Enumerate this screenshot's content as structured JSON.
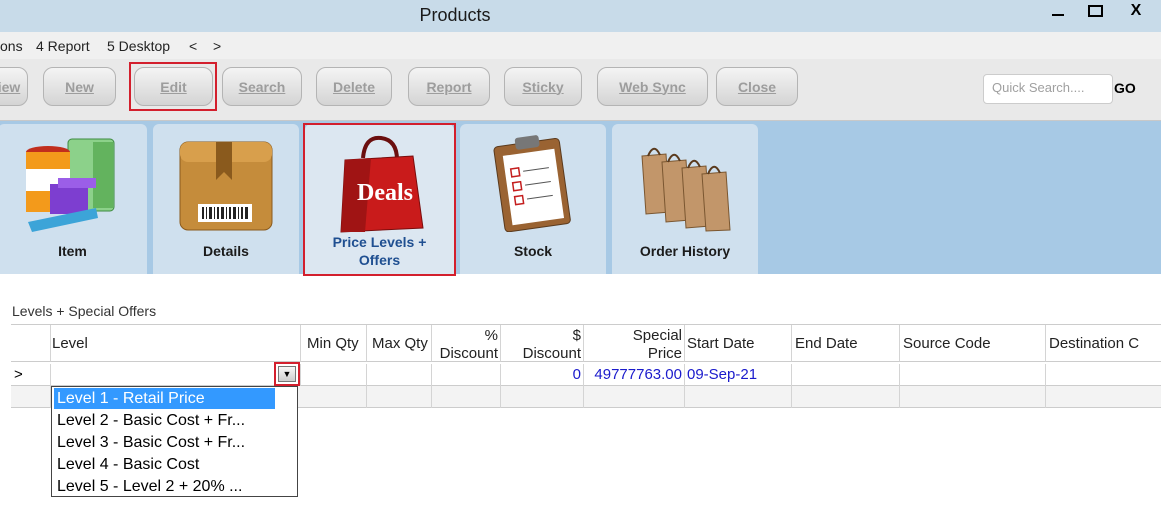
{
  "window": {
    "title": "Products",
    "min_icon": "minimize-icon",
    "max_icon": "maximize-icon",
    "close_icon": "close-icon",
    "close_glyph": "X"
  },
  "menu": {
    "items": [
      "ons",
      "4 Report",
      "5 Desktop",
      "<",
      ">"
    ]
  },
  "toolbar": {
    "buttons": [
      "iew",
      "New",
      "Edit",
      "Search",
      "Delete",
      "Report",
      "Sticky",
      "Web Sync",
      "Close"
    ],
    "search_placeholder": "Quick Search....",
    "go_label": "GO"
  },
  "tabs": [
    {
      "label": "Item",
      "icon": "products-icon"
    },
    {
      "label": "Details",
      "icon": "box-barcode-icon"
    },
    {
      "label_line1": "Price Levels +",
      "label_line2": "Offers",
      "icon": "deals-bag-icon",
      "badge": "Deals",
      "active": true
    },
    {
      "label": "Stock",
      "icon": "inventory-clipboard-icon"
    },
    {
      "label": "Order History",
      "icon": "shopping-bags-icon"
    }
  ],
  "section_title": "Levels + Special Offers",
  "grid": {
    "headers": {
      "level": "Level",
      "min_qty": "Min Qty",
      "max_qty": "Max Qty",
      "pct_discount_1": "%",
      "pct_discount_2": "Discount",
      "dollar_discount_1": "$",
      "dollar_discount_2": "Discount",
      "special_price_1": "Special",
      "special_price_2": "Price",
      "start_date": "Start Date",
      "end_date": "End Date",
      "source_code": "Source Code",
      "destination_code": "Destination C"
    },
    "row1": {
      "marker": ">",
      "pct_discount": "",
      "dollar_discount": "0",
      "special_price": "49777763.00",
      "start_date": "09-Sep-21"
    },
    "dropdown_button": "▼"
  },
  "dropdown": {
    "options": [
      "Level 1 - Retail Price",
      "Level 2 - Basic Cost + Fr...",
      "Level 3 - Basic Cost + Fr...",
      "Level 4 - Basic Cost",
      "Level 5 - Level 2 + 20% ..."
    ],
    "selected_index": 0
  },
  "colors": {
    "highlight": "#d31f2d",
    "link_blue": "#1a1acc",
    "tab_active_text": "#1f4f91",
    "selection": "#3399ff"
  }
}
